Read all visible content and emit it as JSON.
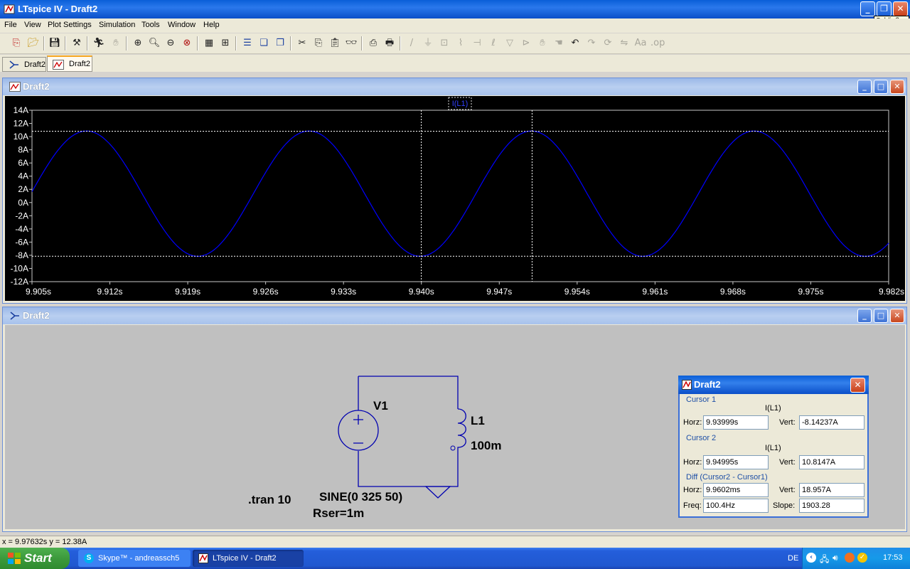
{
  "app": {
    "title": "LTspice IV - Draft2",
    "tooltip": "Schließen"
  },
  "menu": [
    "File",
    "View",
    "Plot Settings",
    "Simulation",
    "Tools",
    "Window",
    "Help"
  ],
  "tabs": [
    {
      "label": "Draft2",
      "kind": "schematic"
    },
    {
      "label": "Draft2",
      "kind": "waveform",
      "active": true
    }
  ],
  "waveform_window": {
    "title": "Draft2",
    "trace_label": "I(L1)"
  },
  "schematic_window": {
    "title": "Draft2"
  },
  "chart_data": {
    "type": "line",
    "series": [
      {
        "name": "I(L1)",
        "color": "#0000ff",
        "amplitude": 9.5,
        "offset": 1.35,
        "frequency_hz": 50,
        "peak_time": 9.9499
      }
    ],
    "xlim": [
      9.905,
      9.982
    ],
    "ylim": [
      -12,
      14
    ],
    "xticks": [
      "9.905s",
      "9.912s",
      "9.919s",
      "9.926s",
      "9.933s",
      "9.940s",
      "9.947s",
      "9.954s",
      "9.961s",
      "9.968s",
      "9.975s",
      "9.982s"
    ],
    "yticks": [
      "14A",
      "12A",
      "10A",
      "8A",
      "6A",
      "4A",
      "2A",
      "0A",
      "-2A",
      "-4A",
      "-6A",
      "-8A",
      "-10A",
      "-12A"
    ],
    "cursors": {
      "x1": 9.93999,
      "x2": 9.94995,
      "y1": -8.14237,
      "y2": 10.8147
    },
    "background": "#000000",
    "grid": false
  },
  "schematic": {
    "source_name": "V1",
    "inductor_name": "L1",
    "inductor_value": "100m",
    "directive": ".tran 10",
    "source_value": "SINE(0 325 50)",
    "source_rser": "Rser=1m"
  },
  "cursor_dialog": {
    "title": "Draft2",
    "cursor1": {
      "label": "Cursor 1",
      "trace": "I(L1)",
      "horz_label": "Horz:",
      "horz": "9.93999s",
      "vert_label": "Vert:",
      "vert": "-8.14237A"
    },
    "cursor2": {
      "label": "Cursor 2",
      "trace": "I(L1)",
      "horz_label": "Horz:",
      "horz": "9.94995s",
      "vert_label": "Vert:",
      "vert": "10.8147A"
    },
    "diff": {
      "label": "Diff (Cursor2 - Cursor1)",
      "horz_label": "Horz:",
      "horz": "9.9602ms",
      "vert_label": "Vert:",
      "vert": "18.957A",
      "freq_label": "Freq:",
      "freq": "100.4Hz",
      "slope_label": "Slope:",
      "slope": "1903.28"
    }
  },
  "status": "x = 9.97632s    y = 12.38A",
  "taskbar": {
    "start": "Start",
    "tasks": [
      {
        "label": "Skype™ - andreassch5"
      },
      {
        "label": "LTspice IV - Draft2"
      }
    ],
    "lang": "DE",
    "clock": "17:53"
  }
}
